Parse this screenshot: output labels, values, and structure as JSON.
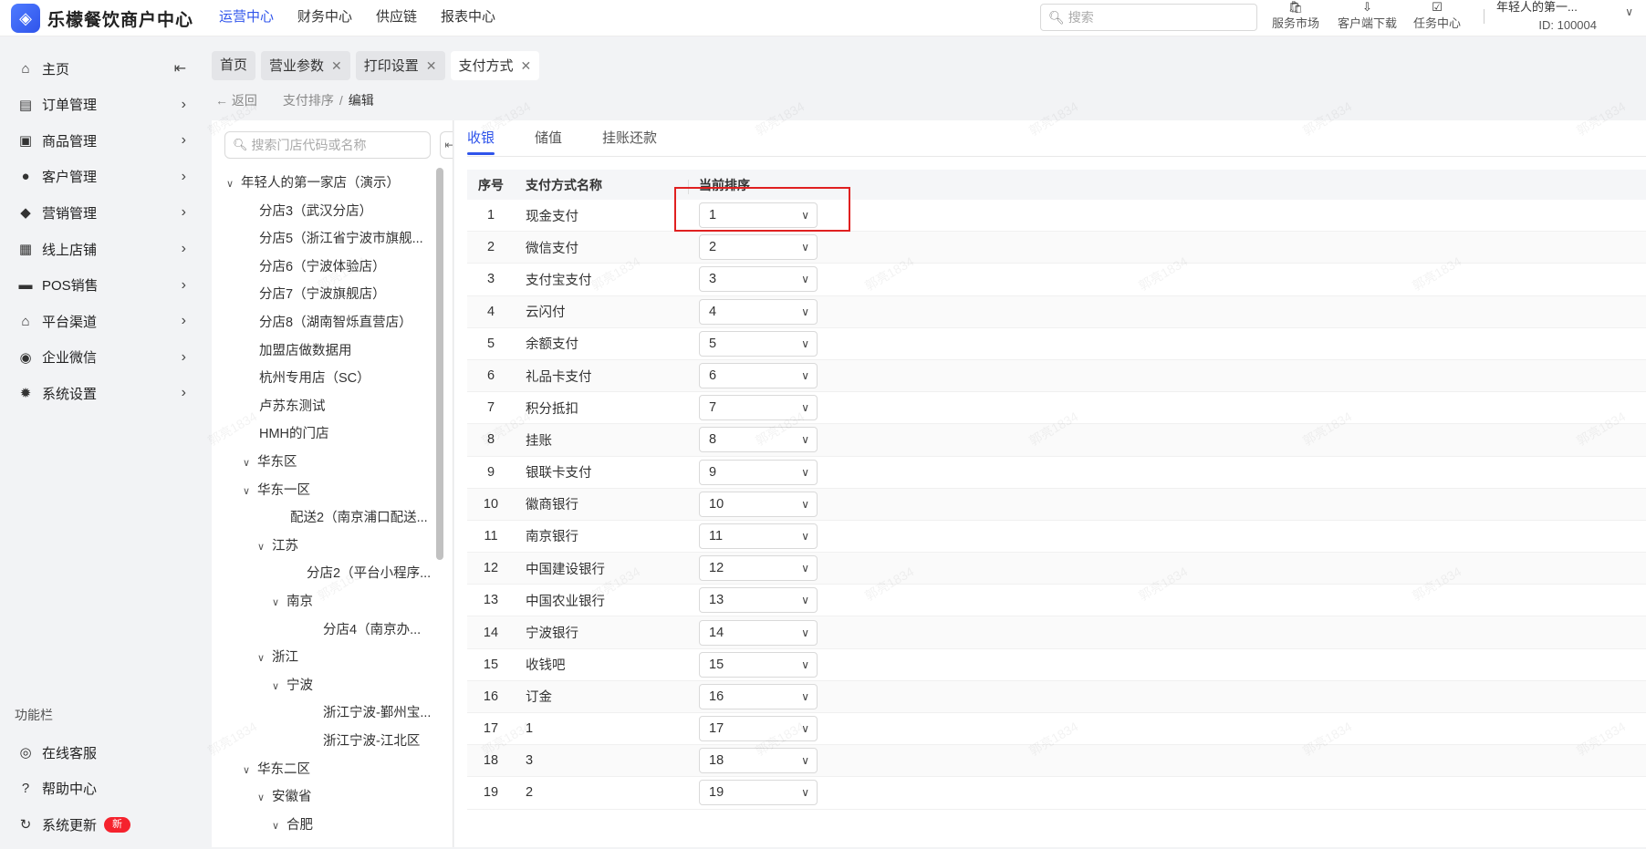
{
  "app": {
    "logo_glyph": "◈",
    "title": "乐檬餐饮商户中心"
  },
  "topnav": [
    {
      "label": "运营中心",
      "active": true
    },
    {
      "label": "财务中心"
    },
    {
      "label": "供应链"
    },
    {
      "label": "报表中心"
    }
  ],
  "search": {
    "placeholder": "搜索"
  },
  "tools": [
    {
      "icon": "🛍",
      "label": "服务市场"
    },
    {
      "icon": "⇩",
      "label": "客户端下载"
    },
    {
      "icon": "☑",
      "label": "任务中心"
    }
  ],
  "user": {
    "name": "年轻人的第一...",
    "id": "ID: 100004"
  },
  "sidebar": {
    "items": [
      {
        "icon": "⌂",
        "label": "主页",
        "arrow": "⇤"
      },
      {
        "icon": "▤",
        "label": "订单管理",
        "arrow": "›"
      },
      {
        "icon": "▣",
        "label": "商品管理",
        "arrow": "›"
      },
      {
        "icon": "●",
        "label": "客户管理",
        "arrow": "›"
      },
      {
        "icon": "◆",
        "label": "营销管理",
        "arrow": "›"
      },
      {
        "icon": "▦",
        "label": "线上店铺",
        "arrow": "›"
      },
      {
        "icon": "▬",
        "label": "POS销售",
        "arrow": "›"
      },
      {
        "icon": "⌂",
        "label": "平台渠道",
        "arrow": "›"
      },
      {
        "icon": "◉",
        "label": "企业微信",
        "arrow": "›"
      },
      {
        "icon": "✹",
        "label": "系统设置",
        "arrow": "›"
      }
    ],
    "section": "功能栏",
    "bottom": [
      {
        "icon": "◎",
        "label": "在线客服"
      },
      {
        "icon": "?",
        "label": "帮助中心"
      },
      {
        "icon": "↻",
        "label": "系统更新",
        "badge": "新"
      }
    ]
  },
  "tabs": [
    {
      "label": "首页",
      "closable": false
    },
    {
      "label": "营业参数",
      "closable": true
    },
    {
      "label": "打印设置",
      "closable": true
    },
    {
      "label": "支付方式",
      "closable": true,
      "active": true
    }
  ],
  "breadcrumb": {
    "back": "返回",
    "parent": "支付排序",
    "current": "编辑"
  },
  "tree": {
    "search_placeholder": "搜索门店代码或名称",
    "nodes": [
      {
        "label": "年轻人的第一家店（演示）",
        "level": 0,
        "toggle": "v"
      },
      {
        "label": "分店3（武汉分店）",
        "level": 1
      },
      {
        "label": "分店5（浙江省宁波市旗舰...",
        "level": 1
      },
      {
        "label": "分店6（宁波体验店）",
        "level": 1
      },
      {
        "label": "分店7（宁波旗舰店）",
        "level": 1
      },
      {
        "label": "分店8（湖南智烁直营店）",
        "level": 1
      },
      {
        "label": "加盟店做数据用",
        "level": 1
      },
      {
        "label": "杭州专用店（SC）",
        "level": 1
      },
      {
        "label": "卢苏东测试",
        "level": 1
      },
      {
        "label": "HMH的门店",
        "level": 1
      },
      {
        "label": "华东区",
        "level": 1,
        "toggle": "v"
      },
      {
        "label": "华东一区",
        "level": 2,
        "toggle": "v"
      },
      {
        "label": "配送2（南京浦口配送...",
        "level": 3
      },
      {
        "label": "江苏",
        "level": 3,
        "toggle": "v"
      },
      {
        "label": "分店2（平台小程序...",
        "level": 4
      },
      {
        "label": "南京",
        "level": 4,
        "toggle": "v"
      },
      {
        "label": "分店4（南京办...",
        "level": 5
      },
      {
        "label": "浙江",
        "level": 3,
        "toggle": "v"
      },
      {
        "label": "宁波",
        "level": 4,
        "toggle": "v"
      },
      {
        "label": "浙江宁波-鄞州宝...",
        "level": 5
      },
      {
        "label": "浙江宁波-江北区",
        "level": 5
      },
      {
        "label": "华东二区",
        "level": 2,
        "toggle": "v"
      },
      {
        "label": "安徽省",
        "level": 3,
        "toggle": "v"
      },
      {
        "label": "合肥",
        "level": 4,
        "toggle": "v"
      }
    ]
  },
  "subtabs": [
    {
      "label": "收银",
      "active": true
    },
    {
      "label": "储值"
    },
    {
      "label": "挂账还款"
    }
  ],
  "table": {
    "headers": {
      "index": "序号",
      "name": "支付方式名称",
      "order": "当前排序"
    },
    "rows": [
      {
        "index": "1",
        "name": "现金支付",
        "order": "1"
      },
      {
        "index": "2",
        "name": "微信支付",
        "order": "2"
      },
      {
        "index": "3",
        "name": "支付宝支付",
        "order": "3"
      },
      {
        "index": "4",
        "name": "云闪付",
        "order": "4"
      },
      {
        "index": "5",
        "name": "余额支付",
        "order": "5"
      },
      {
        "index": "6",
        "name": "礼品卡支付",
        "order": "6"
      },
      {
        "index": "7",
        "name": "积分抵扣",
        "order": "7"
      },
      {
        "index": "8",
        "name": "挂账",
        "order": "8"
      },
      {
        "index": "9",
        "name": "银联卡支付",
        "order": "9"
      },
      {
        "index": "10",
        "name": "徽商银行",
        "order": "10"
      },
      {
        "index": "11",
        "name": "南京银行",
        "order": "11"
      },
      {
        "index": "12",
        "name": "中国建设银行",
        "order": "12"
      },
      {
        "index": "13",
        "name": "中国农业银行",
        "order": "13"
      },
      {
        "index": "14",
        "name": "宁波银行",
        "order": "14"
      },
      {
        "index": "15",
        "name": "收钱吧",
        "order": "15"
      },
      {
        "index": "16",
        "name": "订金",
        "order": "16"
      },
      {
        "index": "17",
        "name": "1",
        "order": "17"
      },
      {
        "index": "18",
        "name": "3",
        "order": "18"
      },
      {
        "index": "19",
        "name": "2",
        "order": "19"
      }
    ]
  },
  "watermark": "郭亮1834",
  "colors": {
    "accent": "#2f54eb",
    "highlight": "#e02020",
    "badge": "#f5222d"
  }
}
